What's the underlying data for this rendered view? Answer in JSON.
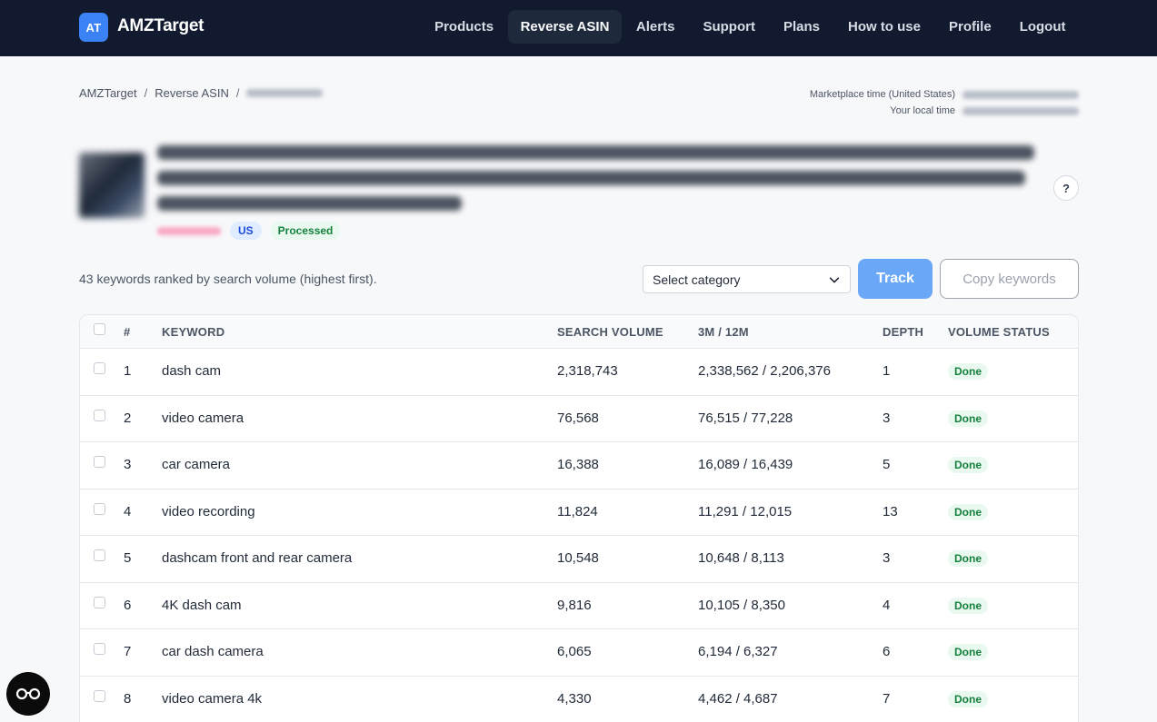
{
  "brand": {
    "badge": "AT",
    "name": "AMZTarget"
  },
  "nav": {
    "items": [
      {
        "label": "Products",
        "active": false
      },
      {
        "label": "Reverse ASIN",
        "active": true
      },
      {
        "label": "Alerts",
        "active": false
      },
      {
        "label": "Support",
        "active": false
      },
      {
        "label": "Plans",
        "active": false
      },
      {
        "label": "How to use",
        "active": false
      },
      {
        "label": "Profile",
        "active": false
      },
      {
        "label": "Logout",
        "active": false
      }
    ]
  },
  "breadcrumb": {
    "root": "AMZTarget",
    "section": "Reverse ASIN",
    "separator": "/"
  },
  "times": {
    "marketplace_label": "Marketplace time (United States)",
    "local_label": "Your local time"
  },
  "product": {
    "marketplace": "US",
    "status": "Processed",
    "help": "?"
  },
  "controls": {
    "summary": "43 keywords ranked by search volume (highest first).",
    "category_placeholder": "Select category",
    "track_label": "Track",
    "copy_label": "Copy keywords"
  },
  "table": {
    "headers": {
      "num": "#",
      "keyword": "KEYWORD",
      "search_volume": "SEARCH VOLUME",
      "trend": "3M / 12M",
      "depth": "DEPTH",
      "status": "VOLUME STATUS"
    },
    "rows": [
      {
        "num": "1",
        "keyword": "dash cam",
        "search_volume": "2,318,743",
        "trend": "2,338,562 / 2,206,376",
        "depth": "1",
        "status": "Done"
      },
      {
        "num": "2",
        "keyword": "video camera",
        "search_volume": "76,568",
        "trend": "76,515 / 77,228",
        "depth": "3",
        "status": "Done"
      },
      {
        "num": "3",
        "keyword": "car camera",
        "search_volume": "16,388",
        "trend": "16,089 / 16,439",
        "depth": "5",
        "status": "Done"
      },
      {
        "num": "4",
        "keyword": "video recording",
        "search_volume": "11,824",
        "trend": "11,291 / 12,015",
        "depth": "13",
        "status": "Done"
      },
      {
        "num": "5",
        "keyword": "dashcam front and rear camera",
        "search_volume": "10,548",
        "trend": "10,648 / 8,113",
        "depth": "3",
        "status": "Done"
      },
      {
        "num": "6",
        "keyword": "4K dash cam",
        "search_volume": "9,816",
        "trend": "10,105 / 8,350",
        "depth": "4",
        "status": "Done"
      },
      {
        "num": "7",
        "keyword": "car dash camera",
        "search_volume": "6,065",
        "trend": "6,194 / 6,327",
        "depth": "6",
        "status": "Done"
      },
      {
        "num": "8",
        "keyword": "video camera 4k",
        "search_volume": "4,330",
        "trend": "4,462 / 4,687",
        "depth": "7",
        "status": "Done"
      }
    ]
  },
  "colors": {
    "topbar": "#111a2e",
    "accent": "#3b82f6",
    "success": "#15803d"
  }
}
